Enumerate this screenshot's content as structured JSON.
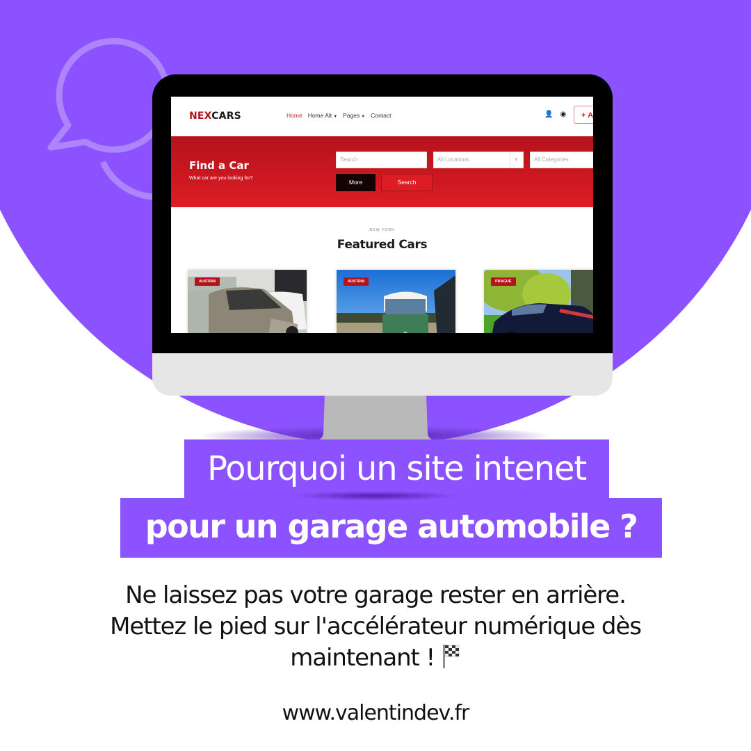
{
  "colors": {
    "brand_purple": "#8c52ff",
    "site_red": "#b5121b",
    "hero_gradient_bottom": "#dd1c25",
    "text_dark": "#111111"
  },
  "website_mockup": {
    "logo": {
      "part1": "NEX",
      "part2": "CARS"
    },
    "nav": [
      {
        "label": "Home",
        "active": true,
        "has_dropdown": false
      },
      {
        "label": "Home Alt",
        "active": false,
        "has_dropdown": true
      },
      {
        "label": "Pages",
        "active": false,
        "has_dropdown": true
      },
      {
        "label": "Contact",
        "active": false,
        "has_dropdown": false
      }
    ],
    "nav_icons": [
      "user-icon",
      "dashboard-icon"
    ],
    "add_button_label": "+ A",
    "hero": {
      "title": "Find a Car",
      "subtitle": "What car are you looking for?",
      "search_placeholder": "Search",
      "location_select": "All Locations",
      "category_select": "All Categories",
      "more_button": "More",
      "search_button": "Search"
    },
    "featured": {
      "kicker": "NEW YORK",
      "title": "Featured Cars",
      "cards": [
        {
          "tag": "AUSTRIA",
          "image": "silver-minivan-showroom"
        },
        {
          "tag": "AUSTRIA",
          "image": "green-van-blue-sky"
        },
        {
          "tag": "PRAGUE",
          "image": "blue-mustang-trees"
        }
      ]
    }
  },
  "headline": {
    "line1": "Pourquoi un site intenet",
    "line2": "pour un garage automobile ?"
  },
  "body": {
    "line1": "Ne laissez pas votre garage rester en arrière.",
    "line2": "Mettez le pied sur l'accélérateur numérique dès",
    "line3": "maintenant !",
    "emoji": "checkered-flag-icon"
  },
  "website_url": "www.valentindev.fr"
}
